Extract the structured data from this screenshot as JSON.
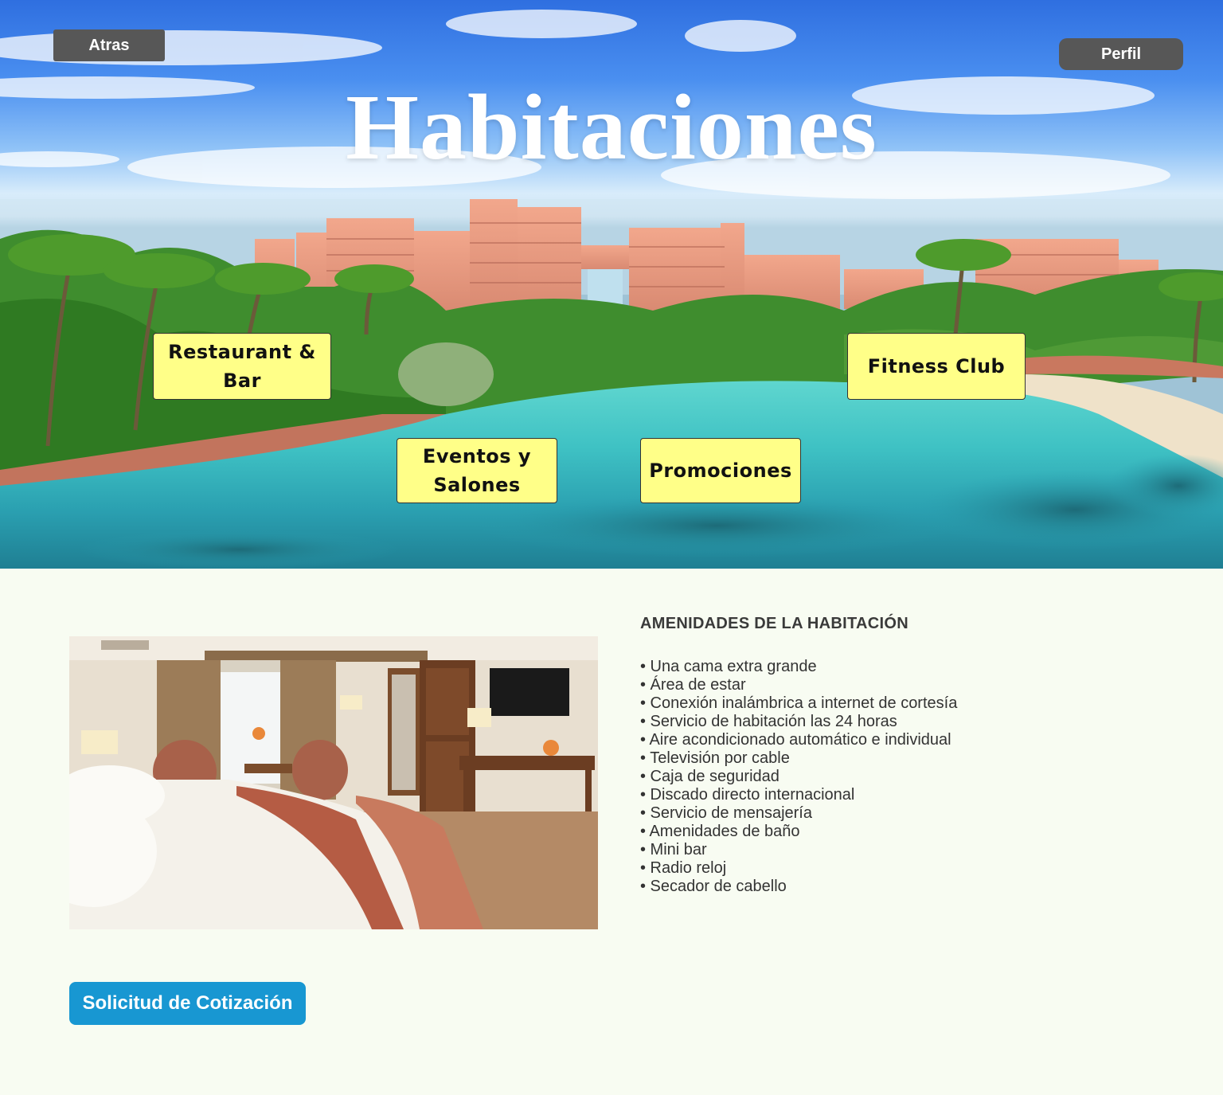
{
  "header": {
    "back_label": "Atras",
    "profile_label": "Perfil",
    "title": "Habitaciones"
  },
  "nav": {
    "restaurant": "Restaurant & Bar",
    "fitness": "Fitness Club",
    "eventos": "Eventos y Salones",
    "promociones": "Promociones"
  },
  "amenities": {
    "heading": "AMENIDADES DE LA HABITACIÓN",
    "items": [
      "• Una cama extra grande",
      "• Área de estar",
      "• Conexión inalámbrica a internet de cortesía",
      "• Servicio de habitación las 24 horas",
      "• Aire acondicionado automático e individual",
      "• Televisión por cable",
      "• Caja de seguridad",
      "• Discado directo internacional",
      "• Servicio de mensajería",
      "• Amenidades de baño",
      "• Mini bar",
      "• Radio reloj",
      "• Secador de cabello"
    ]
  },
  "cta": {
    "quote_label": "Solicitud de Cotización"
  },
  "colors": {
    "nav_box": "#ffff88",
    "dark_button": "#575757",
    "cta_button": "#1897d2",
    "page_background": "#f8fcf2"
  }
}
